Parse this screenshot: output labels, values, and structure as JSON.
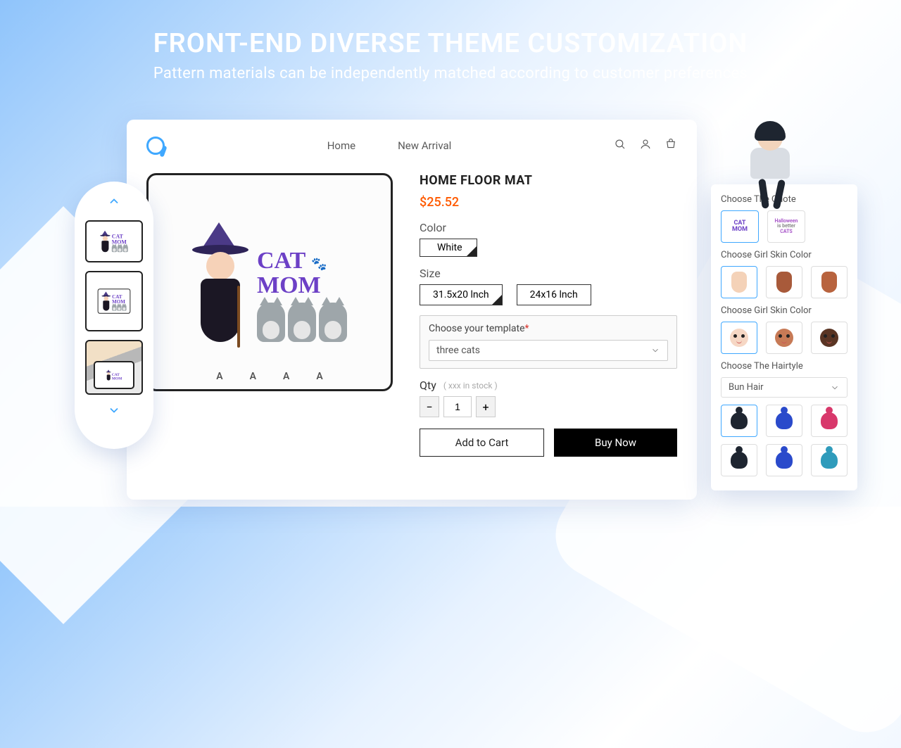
{
  "hero": {
    "title": "FRONT-END DIVERSE THEME CUSTOMIZATION",
    "subtitle": "Pattern materials can be independently matched according to customer preferences"
  },
  "nav": {
    "home": "Home",
    "new_arrival": "New Arrival"
  },
  "product": {
    "title": "HOME FLOOR MAT",
    "price": "$25.52",
    "color_label": "Color",
    "color_value": "White",
    "size_label": "Size",
    "sizes": [
      "31.5x20 lnch",
      "24x16 lnch"
    ],
    "template_label": "Choose your template",
    "template_value": "three cats",
    "qty_label": "Qty",
    "stock_hint": "( xxx in stock )",
    "qty_value": "1",
    "add_to_cart": "Add to Cart",
    "buy_now": "Buy Now",
    "mat_quote_line1": "CAT",
    "mat_quote_line2": "MOM",
    "name_placeholder": "A"
  },
  "custom": {
    "quote": {
      "title": "Choose The Quote",
      "opt1_l1": "CAT",
      "opt1_l2": "MOM",
      "opt2_l1": "Halloween",
      "opt2_l2": "is better",
      "opt2_l3": "CATS"
    },
    "skin1": {
      "title": "Choose Girl Skin Color"
    },
    "skin2": {
      "title": "Choose Girl Skin Color"
    },
    "hair": {
      "title": "Choose The Hairtyle",
      "select_value": "Bun Hair"
    }
  },
  "colors": {
    "skin_tones": [
      "#f4d2b8",
      "#a85a3a",
      "#b8633e"
    ],
    "face_tones": [
      "#f6d7c4",
      "#c77a56",
      "#5a3524"
    ],
    "hair_row1": [
      "#1e2530",
      "#2a4acb",
      "#d8386b"
    ],
    "hair_row2": [
      "#1e2530",
      "#2a4acb",
      "#2f9bbb"
    ]
  }
}
